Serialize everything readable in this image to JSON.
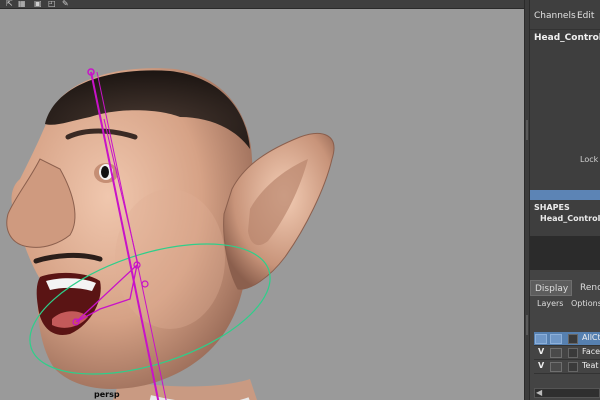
{
  "viewport": {
    "camera_label": "persp",
    "background_color": "#9a9a9a",
    "toolbar_icons": [
      "select-arrow-icon",
      "grid-icon",
      "camera-icon",
      "tool-icon"
    ]
  },
  "channel_box": {
    "menu": {
      "channels": "Channels",
      "edit": "Edit"
    },
    "object_name": "Head_Control",
    "lock_label": "Lock E",
    "shapes_header": "SHAPES",
    "shapes_item": "Head_ControlS"
  },
  "layer_editor": {
    "tabs": {
      "display": "Display",
      "render": "Rend"
    },
    "submenu": {
      "layers": "Layers",
      "options": "Options"
    },
    "rows": [
      {
        "visible": "",
        "name": "AllCt",
        "selected": true
      },
      {
        "visible": "V",
        "name": "Face",
        "selected": false
      },
      {
        "visible": "V",
        "name": "Teat",
        "selected": false
      }
    ]
  },
  "colors": {
    "rig_curve": "#c812c8",
    "ring_curve": "#2ecf8a",
    "selection": "#5680b0",
    "skin": "#d9a98e"
  }
}
